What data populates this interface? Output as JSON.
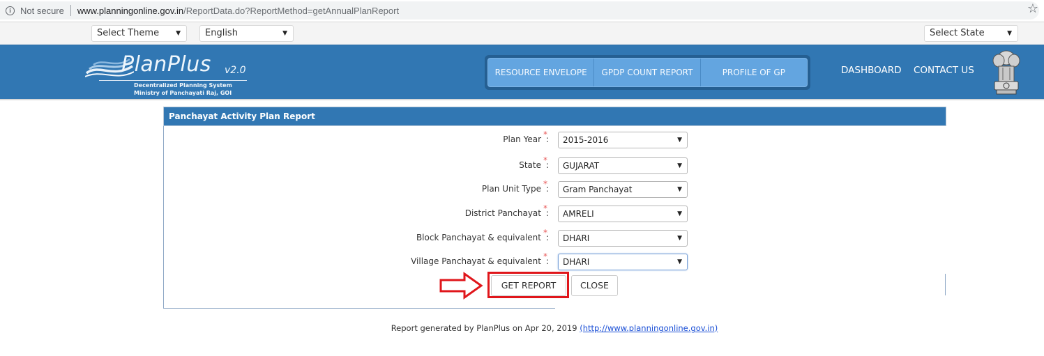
{
  "browser": {
    "security_label": "Not secure",
    "url_host": "www.planningonline.gov.in",
    "url_path": "/ReportData.do?ReportMethod=getAnnualPlanReport",
    "icons": {
      "info": "info-circle-icon",
      "bookmark": "star-outline-icon"
    }
  },
  "topbar": {
    "theme_select": "Select Theme",
    "language_select": "English",
    "state_select": "Select State"
  },
  "header": {
    "logo": {
      "title": "PlanPlus",
      "version": "v2.0",
      "subtitle1": "Decentralized Planning System",
      "subtitle2": "Ministry of Panchayati Raj, GOI"
    },
    "nav_buttons": [
      {
        "label": "RESOURCE ENVELOPE"
      },
      {
        "label": "GPDP COUNT REPORT"
      },
      {
        "label": "PROFILE OF GP"
      }
    ],
    "links": [
      {
        "label": "DASHBOARD"
      },
      {
        "label": "CONTACT US"
      }
    ],
    "emblem": "national-emblem-icon"
  },
  "panel": {
    "title": "Panchayat Activity Plan Report",
    "fields": [
      {
        "label": "Plan Year",
        "required": "*",
        "value": "2015-2016"
      },
      {
        "label": "State",
        "required": "*",
        "value": "GUJARAT"
      },
      {
        "label": "Plan Unit Type",
        "required": "*",
        "value": "Gram Panchayat"
      },
      {
        "label": "District Panchayat",
        "required": "*",
        "value": "AMRELI"
      },
      {
        "label": "Block Panchayat & equivalent",
        "required": "*",
        "value": "DHARI"
      },
      {
        "label": "Village Panchayat & equivalent",
        "required": "*",
        "value": "DHARI"
      }
    ],
    "colon": ":",
    "get_report_label": "GET REPORT",
    "close_label": "CLOSE"
  },
  "footer": {
    "text": "Report generated by PlanPlus on Apr 20, 2019 ",
    "link": "(http://www.planningonline.gov.in)"
  },
  "colors": {
    "header_blue": "#3177b3",
    "nav_button": "#63a5e0",
    "highlight_red": "#e0161b",
    "required_star": "#e85a5a"
  }
}
